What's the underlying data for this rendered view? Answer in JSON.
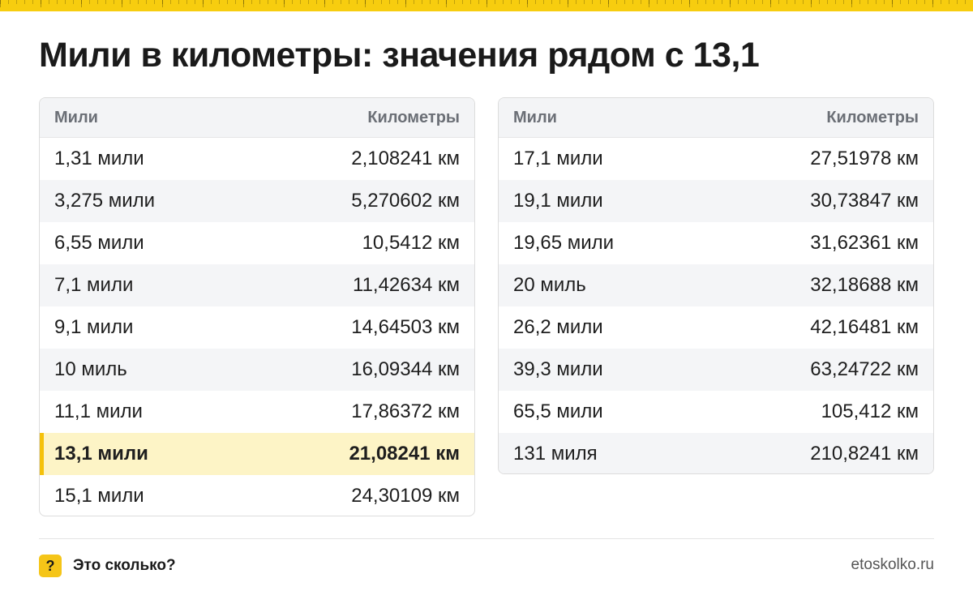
{
  "title": "Мили в километры: значения рядом с 13,1",
  "tables": {
    "left": {
      "header": {
        "col1": "Мили",
        "col2": "Километры"
      },
      "rows": [
        {
          "miles": "1,31 мили",
          "km": "2,108241 км"
        },
        {
          "miles": "3,275 мили",
          "km": "5,270602 км"
        },
        {
          "miles": "6,55 мили",
          "km": "10,5412 км"
        },
        {
          "miles": "7,1 мили",
          "km": "11,42634 км"
        },
        {
          "miles": "9,1 мили",
          "km": "14,64503 км"
        },
        {
          "miles": "10 миль",
          "km": "16,09344 км"
        },
        {
          "miles": "11,1 мили",
          "km": "17,86372 км"
        },
        {
          "miles": "13,1 мили",
          "km": "21,08241 км",
          "highlighted": true
        },
        {
          "miles": "15,1 мили",
          "km": "24,30109 км"
        }
      ]
    },
    "right": {
      "header": {
        "col1": "Мили",
        "col2": "Километры"
      },
      "rows": [
        {
          "miles": "17,1 мили",
          "km": "27,51978 км"
        },
        {
          "miles": "19,1 мили",
          "km": "30,73847 км"
        },
        {
          "miles": "19,65 мили",
          "km": "31,62361 км"
        },
        {
          "miles": "20 миль",
          "km": "32,18688 км"
        },
        {
          "miles": "26,2 мили",
          "km": "42,16481 км"
        },
        {
          "miles": "39,3 мили",
          "km": "63,24722 км"
        },
        {
          "miles": "65,5 мили",
          "km": "105,412 км"
        },
        {
          "miles": "131 миля",
          "km": "210,8241 км"
        }
      ]
    }
  },
  "footer": {
    "brand_icon": "?",
    "brand_name": "Это сколько?",
    "site": "etoskolko.ru"
  },
  "colors": {
    "accent": "#f5c518",
    "highlight_row": "#fdf4c6",
    "ruler": "#f7cd0f"
  }
}
